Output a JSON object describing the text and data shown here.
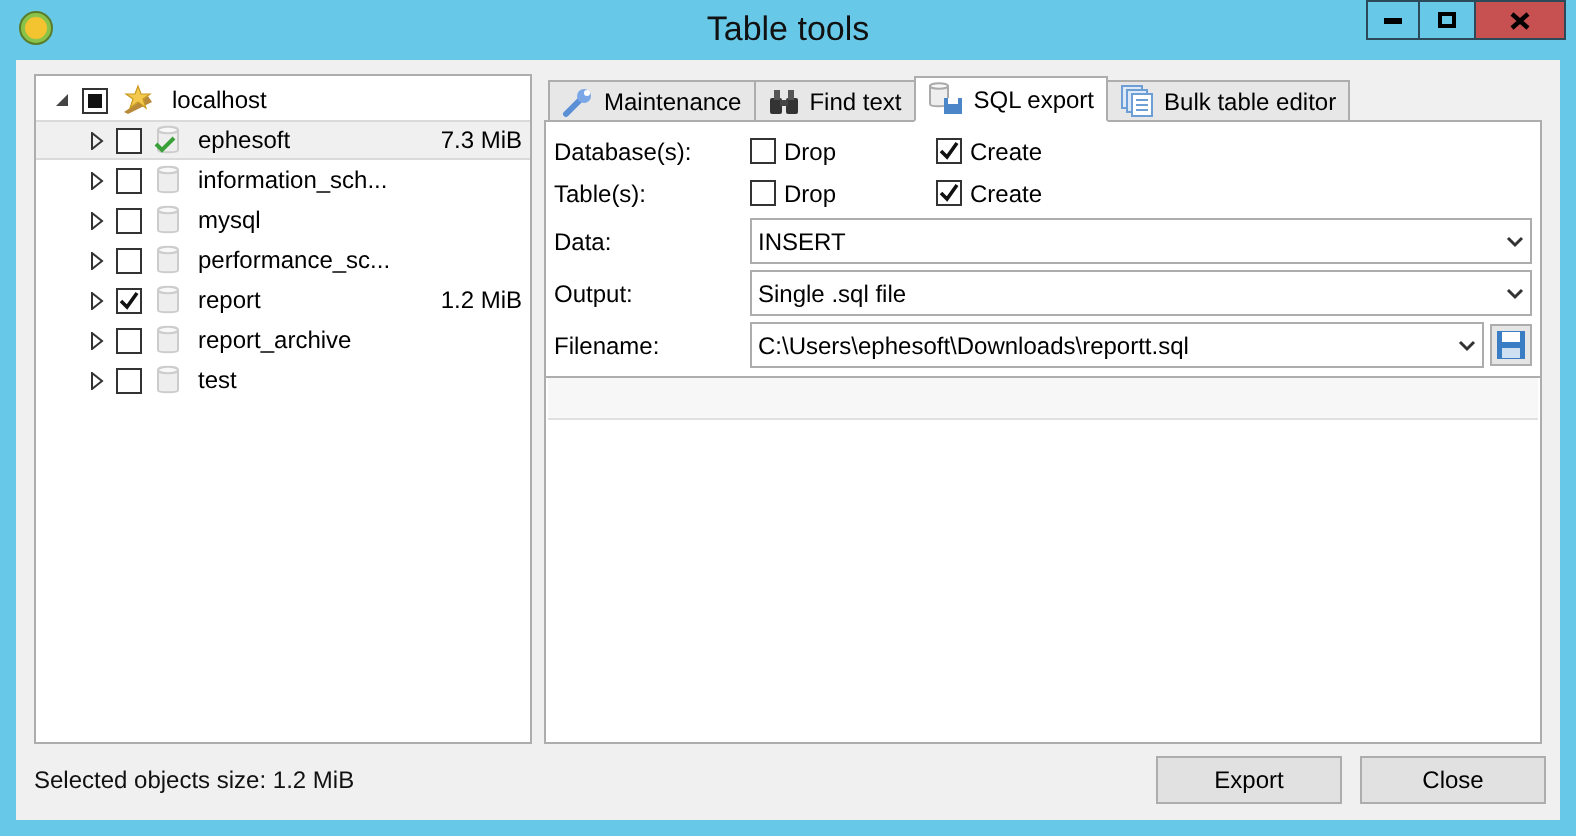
{
  "window": {
    "title": "Table tools"
  },
  "tree": {
    "label": "localhost",
    "expanded": true,
    "checked": false,
    "partial": true,
    "children": [
      {
        "label": "ephesoft",
        "size": "7.3 MiB",
        "checked": false,
        "selected": true,
        "active": true,
        "expanded": false
      },
      {
        "label": "information_sch...",
        "checked": false,
        "selected": false,
        "active": false,
        "expanded": false
      },
      {
        "label": "mysql",
        "checked": false,
        "selected": false,
        "active": false,
        "expanded": false
      },
      {
        "label": "performance_sc...",
        "checked": false,
        "selected": false,
        "active": false,
        "expanded": false
      },
      {
        "label": "report",
        "size": "1.2 MiB",
        "checked": true,
        "selected": false,
        "active": false,
        "expanded": false
      },
      {
        "label": "report_archive",
        "checked": false,
        "selected": false,
        "active": false,
        "expanded": false
      },
      {
        "label": "test",
        "checked": false,
        "selected": false,
        "active": false,
        "expanded": false
      }
    ]
  },
  "tabs": [
    {
      "label": "Maintenance",
      "selected": false
    },
    {
      "label": "Find text",
      "selected": false
    },
    {
      "label": "SQL export",
      "selected": true
    },
    {
      "label": "Bulk table editor",
      "selected": false
    }
  ],
  "options": [
    {
      "label": "Database(s):",
      "checks": [
        {
          "label": "Drop",
          "checked": false
        },
        {
          "label": "Create",
          "checked": true
        }
      ]
    },
    {
      "label": "Table(s):",
      "checks": [
        {
          "label": "Drop",
          "checked": false
        },
        {
          "label": "Create",
          "checked": true
        }
      ]
    }
  ],
  "fields": [
    {
      "label": "Data:",
      "value": "INSERT",
      "save_button": false
    },
    {
      "label": "Output:",
      "value": "Single .sql file",
      "save_button": false
    },
    {
      "label": "Filename:",
      "value": "C:\\Users\\ephesoft\\Downloads\\reportt.sql",
      "save_button": true
    }
  ],
  "status": "Selected objects size: 1.2 MiB",
  "buttons": [
    "Export",
    "Close"
  ]
}
